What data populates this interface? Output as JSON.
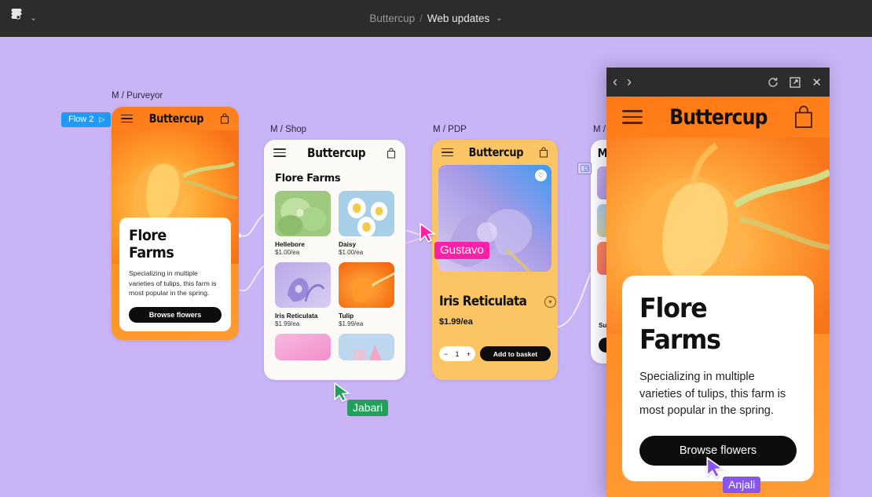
{
  "topbar": {
    "logo_icon": "figma-logo-icon",
    "menu_chevron": "⌄",
    "project_name": "Buttercup",
    "separator": "/",
    "page_name": "Web updates",
    "page_chevron": "⌄"
  },
  "canvas": {
    "background_color": "#c9b5f5",
    "flow_badge": {
      "label": "Flow 2",
      "play_icon": "▷"
    }
  },
  "frames": [
    {
      "label": "M / Purveyor",
      "brand": "Buttercup",
      "menu_icon": "hamburger-icon",
      "bag_icon": "shopping-bag-icon",
      "card": {
        "title": "Flore Farms",
        "description": "Specializing in multiple varieties of tulips, this farm is most popular in the spring.",
        "button": "Browse flowers"
      }
    },
    {
      "label": "M / Shop",
      "brand": "Buttercup",
      "heading": "Flore Farms",
      "products": [
        {
          "name": "Hellebore",
          "price": "$1.00/ea"
        },
        {
          "name": "Daisy",
          "price": "$1.00/ea"
        },
        {
          "name": "Iris Reticulata",
          "price": "$1.99/ea"
        },
        {
          "name": "Tulip",
          "price": "$1.99/ea"
        }
      ]
    },
    {
      "label": "M / PDP",
      "brand": "Buttercup",
      "favorite_icon": "heart-icon",
      "title": "Iris Reticulata",
      "price": "$1.99/ea",
      "quantity": "1",
      "minus": "−",
      "plus": "+",
      "add_button": "Add to basket",
      "expand_icon": "chevron-down-circle-icon"
    },
    {
      "label": "M / C",
      "brand_partial": "M",
      "subtotal_partial": "Sub"
    }
  ],
  "preview": {
    "back_icon": "‹",
    "forward_icon": "›",
    "restart_icon": "restart-icon",
    "open_external_icon": "open-external-icon",
    "close_icon": "✕",
    "brand": "Buttercup",
    "menu_icon": "hamburger-icon",
    "bag_icon": "shopping-bag-icon",
    "card": {
      "title": "Flore Farms",
      "description": "Specializing in multiple varieties of tulips, this farm is most popular in the spring.",
      "button": "Browse flowers"
    }
  },
  "cursors": [
    {
      "name": "Jabari",
      "color": "#22a05b"
    },
    {
      "name": "Gustavo",
      "color": "#ff1fa8"
    },
    {
      "name": "Anjali",
      "color": "#8855f0"
    }
  ]
}
